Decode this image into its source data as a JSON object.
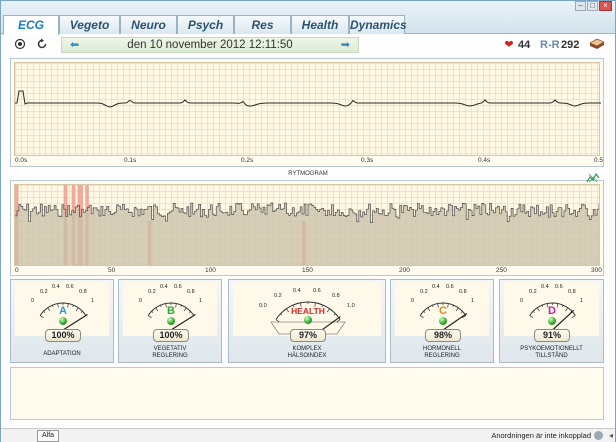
{
  "tabs": [
    {
      "label": "ECG",
      "active": true
    },
    {
      "label": "Vegeto",
      "active": false
    },
    {
      "label": "Neuro",
      "active": false
    },
    {
      "label": "Psych",
      "active": false
    },
    {
      "label": "Res",
      "active": false
    },
    {
      "label": "Health",
      "active": false
    },
    {
      "label": "Dynamics",
      "active": false
    }
  ],
  "toolbar": {
    "date": "den 10 november 2012 12:11:50",
    "hr_value": "44",
    "rr_label": "R-R",
    "rr_value": "292"
  },
  "ecg": {
    "x_ticks": [
      "0.0s",
      "0.1s",
      "0.2s",
      "0.3s",
      "0.4s",
      "0.5"
    ]
  },
  "rytmogram": {
    "title": "RYTMOGRAM",
    "x_ticks": [
      "0",
      "50",
      "100",
      "150",
      "200",
      "250",
      "300"
    ],
    "highlight_positions": [
      0,
      25,
      29,
      32,
      33,
      36,
      68,
      147
    ]
  },
  "gauges": [
    {
      "letter": "A",
      "letter_color": "#2a9ad6",
      "value": "100%",
      "fraction": 1.0,
      "label_lines": [
        "ADAPTATION"
      ],
      "scale": [
        "0",
        "0.2",
        "0.4",
        "0.6",
        "0.8",
        "1"
      ]
    },
    {
      "letter": "B",
      "letter_color": "#2aa83a",
      "value": "100%",
      "fraction": 1.0,
      "label_lines": [
        "VEGETATIV",
        "REGLERING"
      ],
      "scale": [
        "0",
        "0.2",
        "0.4",
        "0.6",
        "0.8",
        "1"
      ]
    },
    {
      "letter": "HEALTH",
      "letter_color": "#d02a2a",
      "value": "97%",
      "fraction": 0.97,
      "label_lines": [
        "KOMPLEX",
        "HÄLSOINDEX"
      ],
      "scale": [
        "0.0",
        "0.2",
        "0.4",
        "0.6",
        "0.8",
        "1.0"
      ]
    },
    {
      "letter": "C",
      "letter_color": "#e08a1a",
      "value": "98%",
      "fraction": 0.98,
      "label_lines": [
        "HORMONELL",
        "REGLERING"
      ],
      "scale": [
        "0",
        "0.2",
        "0.4",
        "0.6",
        "0.8",
        "1"
      ]
    },
    {
      "letter": "D",
      "letter_color": "#c21ec0",
      "value": "91%",
      "fraction": 0.91,
      "label_lines": [
        "PSYKOEMOTIONELLT",
        "TILLSTÅND"
      ],
      "scale": [
        "0",
        "0.2",
        "0.4",
        "0.6",
        "0.8",
        "1"
      ]
    }
  ],
  "status": {
    "alfa": "Alfa",
    "message": "Anordningen är inte inkopplad"
  }
}
